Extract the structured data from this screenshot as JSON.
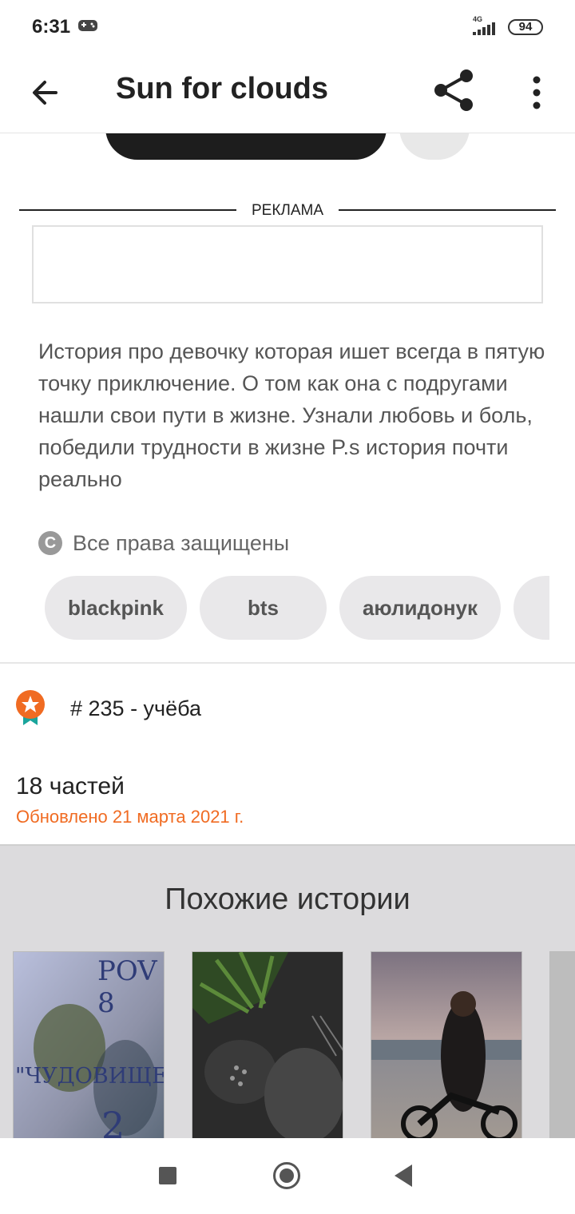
{
  "status_bar": {
    "time": "6:31",
    "network": "4G",
    "battery": "94",
    "icons": [
      "gamepad-icon",
      "signal-icon",
      "battery-icon"
    ]
  },
  "header": {
    "title": "Sun for clouds",
    "back_icon": "arrow-left-icon",
    "share_icon": "share-icon",
    "more_icon": "more-vertical-icon"
  },
  "ad": {
    "label": "РЕКЛАМА"
  },
  "story": {
    "description": "История про девочку которая ишет всегда в пятую точку приключение. О том как она с подругами нашли свои пути в жизне. Узнали любовь и боль, победили трудности в жизне P.s история почти реально",
    "rights": "Все права защищены",
    "tags": [
      "blackpink",
      "bts",
      "аюлидонук"
    ],
    "rank": "# 235 - учёба",
    "parts": "18 частей",
    "updated": "Обновлено 21 марта 2021 г."
  },
  "similar": {
    "title": "Похожие истории",
    "covers": [
      {
        "name": "cover-1",
        "text_top": "POV 8",
        "text_mid": "\"ЧУДОВИЩЕ\"",
        "text_bottom": "2"
      },
      {
        "name": "cover-2"
      },
      {
        "name": "cover-3"
      }
    ]
  },
  "colors": {
    "accent": "#f06b22",
    "dark_button": "#1d1d1d",
    "chip_bg": "#e9e8ea",
    "similar_bg": "#dcdbdd"
  }
}
